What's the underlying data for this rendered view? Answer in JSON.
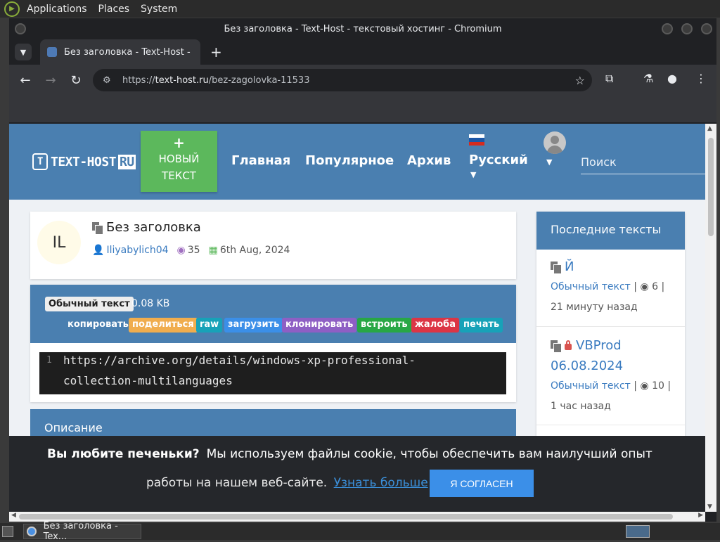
{
  "top_panel": {
    "menus": [
      "Applications",
      "Places",
      "System"
    ]
  },
  "window": {
    "title": "Без заголовка - Text-Host - текстовый хостинг - Chromium"
  },
  "tab": {
    "title": "Без заголовка - Text-Host - "
  },
  "omnibox": {
    "scheme": "https://",
    "host": "text-host.ru",
    "path": "/bez-zagolovka-11533"
  },
  "site": {
    "logo": {
      "badge": "T",
      "text": "TEXT-HOST",
      "ru": "RU"
    },
    "new_text": {
      "plus": "+",
      "line1": "НОВЫЙ",
      "line2": "ТЕКСТ"
    },
    "nav": [
      "Главная",
      "Популярное",
      "Архив"
    ],
    "language": "Русский",
    "search_placeholder": "Поиск"
  },
  "paste": {
    "avatar_initials": "IL",
    "title": "Без заголовка",
    "author": "Iliyabylich04",
    "views": "35",
    "date": "6th Aug, 2024",
    "type": "Обычный текст",
    "size": "0.08 KB",
    "actions": [
      {
        "label": "копировать",
        "color": "#4a7fb0"
      },
      {
        "label": "поделиться",
        "color": "#f0ad4e"
      },
      {
        "label": "raw",
        "color": "#17a2b8"
      },
      {
        "label": "загрузить",
        "color": "#3b8fe8"
      },
      {
        "label": "клонировать",
        "color": "#8e5fc4"
      },
      {
        "label": "встроить",
        "color": "#28a745"
      },
      {
        "label": "жалоба",
        "color": "#dc3545"
      },
      {
        "label": "печать",
        "color": "#17a2b8"
      }
    ],
    "code_line_number": "1",
    "code_line1": "https://archive.org/details/windows-xp-professional-",
    "code_line2": "collection-multilanguages",
    "description_heading": "Описание"
  },
  "sidebar": {
    "heading": "Последние тексты",
    "items": [
      {
        "title": "Й",
        "type": "Обычный текст",
        "views": "6",
        "time": "21 минуту назад",
        "locked": false
      },
      {
        "title_line1": "VBProd",
        "title_line2": "06.08.2024",
        "type": "Обычный текст",
        "views": "10",
        "time": "1 час назад",
        "locked": true
      }
    ]
  },
  "cookie": {
    "question": "Вы любите печеньки?",
    "text1": "Мы используем файлы cookie, чтобы обеспечить вам наилучший опыт",
    "text2": "работы на нашем веб-сайте.",
    "link": "Узнать больше",
    "accept": "Я СОГЛАСЕН"
  },
  "taskbar": {
    "item": "Без заголовка - Tex..."
  },
  "colors": {
    "brand": "#4a7fb0",
    "green": "#5cb85c",
    "link": "#3a7bc0"
  }
}
